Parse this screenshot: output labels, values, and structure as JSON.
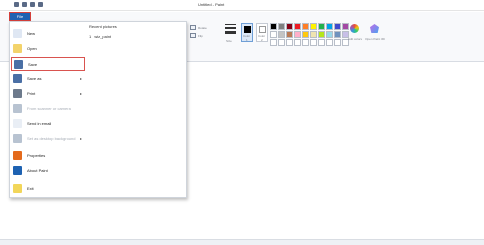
{
  "window": {
    "title": "Untitled - Paint"
  },
  "file_tab": {
    "label": "File"
  },
  "ribbon": {
    "text_rotate": "Rotate",
    "text_flip": "Flip",
    "size_label": "Size",
    "color1_label": "Color",
    "color1_number": "1",
    "color2_label": "Color",
    "color2_number": "2",
    "edit_colors_label": "Edit colors",
    "paint3d_label": "Open Paint 3D",
    "colors_group_label": "Colors",
    "palette": [
      "#000000",
      "#7f7f7f",
      "#880015",
      "#ed1c24",
      "#ff7f27",
      "#fff200",
      "#22b14c",
      "#00a2e8",
      "#3f48cc",
      "#a349a4",
      "#ffffff",
      "#c3c3c3",
      "#b97a57",
      "#ffaec9",
      "#ffc90e",
      "#efe4b0",
      "#b5e61d",
      "#99d9ea",
      "#7092be",
      "#c8bfe7",
      "#ffffff",
      "#ffffff",
      "#ffffff",
      "#ffffff",
      "#ffffff",
      "#ffffff",
      "#ffffff",
      "#ffffff",
      "#ffffff",
      "#ffffff"
    ]
  },
  "file_menu": {
    "items": [
      {
        "label": "New",
        "icon": "new-file-icon",
        "color": "#dfe7f3",
        "disabled": false,
        "arrow": ""
      },
      {
        "label": "Open",
        "icon": "open-folder-icon",
        "color": "#f3d36b",
        "disabled": false,
        "arrow": ""
      },
      {
        "label": "Save",
        "icon": "save-disk-icon",
        "color": "#4a6fa5",
        "disabled": false,
        "arrow": ""
      },
      {
        "label": "Save as",
        "icon": "save-as-icon",
        "color": "#4a6fa5",
        "disabled": false,
        "arrow": "▸"
      },
      {
        "label": "Print",
        "icon": "printer-icon",
        "color": "#6d7a8c",
        "disabled": false,
        "arrow": "▸"
      },
      {
        "label": "From scanner or camera",
        "icon": "scanner-icon",
        "color": "#b8c3d1",
        "disabled": true,
        "arrow": ""
      },
      {
        "label": "Send in email",
        "icon": "email-icon",
        "color": "#e9eef5",
        "disabled": false,
        "arrow": ""
      },
      {
        "label": "Set as desktop background",
        "icon": "desktop-background-icon",
        "color": "#b8c3d1",
        "disabled": true,
        "arrow": "▸"
      },
      {
        "label": "Properties",
        "icon": "checkmark-icon",
        "color": "#e46a1c",
        "disabled": false,
        "arrow": ""
      },
      {
        "label": "About Paint",
        "icon": "info-icon",
        "color": "#1e62b2",
        "disabled": false,
        "arrow": ""
      },
      {
        "label": "Exit",
        "icon": "exit-icon",
        "color": "#f2d65a",
        "disabled": false,
        "arrow": ""
      }
    ],
    "recent_heading": "Recent pictures",
    "recent_items": [
      {
        "number": "1",
        "name": "wiz_paint"
      }
    ]
  }
}
